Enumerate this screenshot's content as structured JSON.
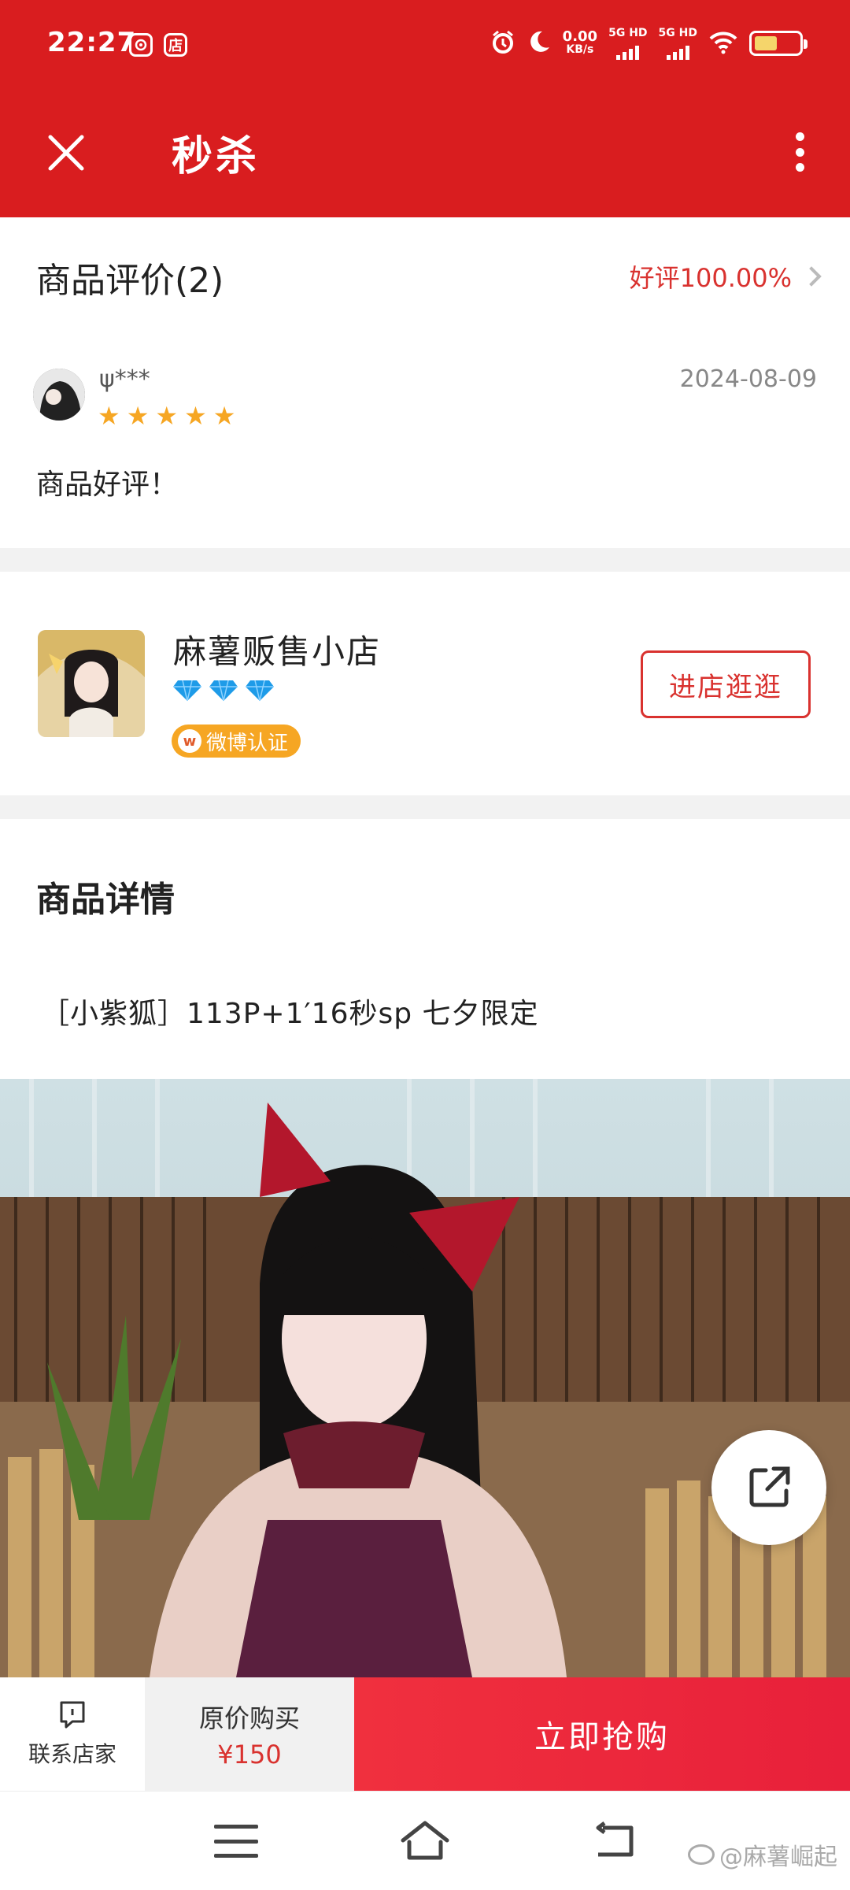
{
  "status_bar": {
    "time": "22:27",
    "app_badge_1": "",
    "app_badge_2": "店",
    "net_speed_value": "0.00",
    "net_speed_unit": "KB/s",
    "sim1": "5G HD",
    "sim2": "5G HD",
    "icons": [
      "alarm-icon",
      "moon-icon",
      "wifi-icon",
      "battery-icon"
    ]
  },
  "header": {
    "title": "秒杀",
    "close_icon": "close-icon",
    "more_icon": "more-vertical-icon"
  },
  "review_section": {
    "title": "商品评价(2)",
    "rating": "好评100.00%",
    "review": {
      "user": "ψ***",
      "stars": 5,
      "date": "2024-08-09",
      "comment": "商品好评！"
    }
  },
  "shop": {
    "name": "麻薯贩售小店",
    "diamond_level": 3,
    "badge": "微博认证",
    "enter_button": "进店逛逛"
  },
  "details": {
    "title": "商品详情",
    "description": "［小紫狐］113P+1′16秒sp 七夕限定"
  },
  "action_bar": {
    "contact_label": "联系店家",
    "original_label": "原价购买",
    "original_price": "¥150",
    "buy_label": "立即抢购"
  },
  "watermark": "@麻薯崛起",
  "colors": {
    "brand_red": "#d91d1f",
    "accent_red": "#d9322f",
    "star_gold": "#f6a623",
    "diamond_blue": "#1e9be8"
  }
}
